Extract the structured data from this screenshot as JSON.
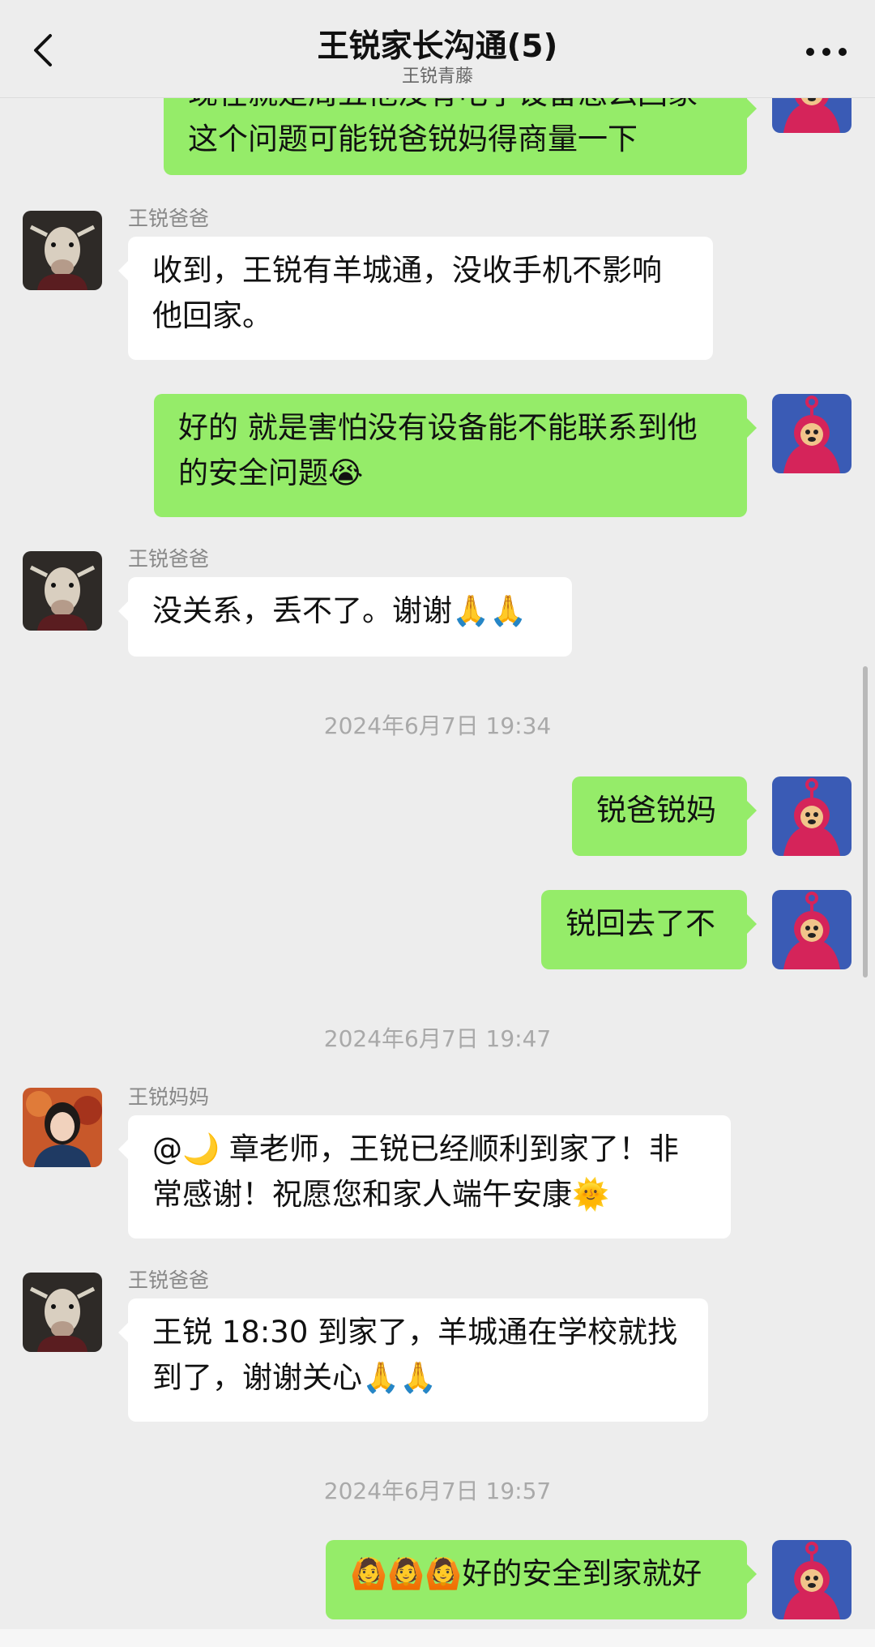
{
  "header": {
    "title": "王锐家长沟通(5)",
    "subtitle": "王锐青藤",
    "back_icon": "chevron-left-icon",
    "more_icon": "more-dots-icon"
  },
  "colors": {
    "background": "#ededed",
    "outgoing_bubble": "#95ec69",
    "incoming_bubble": "#ffffff",
    "timestamp_text": "#a9a9a9"
  },
  "messages": [
    {
      "direction": "out",
      "text": "现在就是周五他没有电子设备怎么回家\n这个问题可能锐爸锐妈得商量一下"
    },
    {
      "direction": "in",
      "sender": "王锐爸爸",
      "text": "收到，王锐有羊城通，没收手机不影响\n他回家。"
    },
    {
      "direction": "out",
      "text": "好的 就是害怕没有设备能不能联系到他\n的安全问题😭"
    },
    {
      "direction": "in",
      "sender": "王锐爸爸",
      "text": "没关系，丢不了。谢谢🙏🙏"
    },
    {
      "type": "time",
      "text": "2024年6月7日 19:34"
    },
    {
      "direction": "out",
      "text": "锐爸锐妈"
    },
    {
      "direction": "out",
      "text": "锐回去了不"
    },
    {
      "type": "time",
      "text": "2024年6月7日 19:47"
    },
    {
      "direction": "in",
      "sender": "王锐妈妈",
      "text": "@🌙 章老师，王锐已经顺利到家了！非\n常感谢！祝愿您和家人端午安康🌞"
    },
    {
      "direction": "in",
      "sender": "王锐爸爸",
      "text": "王锐 18:30 到家了，羊城通在学校就找\n到了，谢谢关心🙏🙏"
    },
    {
      "type": "time",
      "text": "2024年6月7日 19:57"
    },
    {
      "direction": "out",
      "text": "🙆🙆🙆好的安全到家就好"
    }
  ]
}
